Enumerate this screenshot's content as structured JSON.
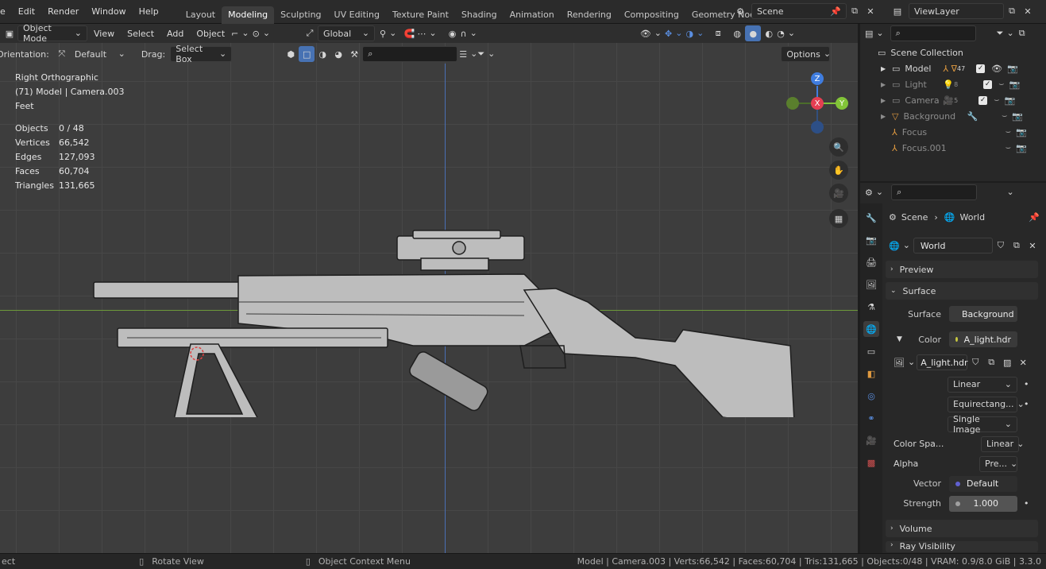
{
  "menu": [
    "e",
    "Edit",
    "Render",
    "Window",
    "Help"
  ],
  "workspaces": [
    "Layout",
    "Modeling",
    "Sculpting",
    "UV Editing",
    "Texture Paint",
    "Shading",
    "Animation",
    "Rendering",
    "Compositing",
    "Geometry Noc"
  ],
  "active_workspace": "Modeling",
  "scene_name": "Scene",
  "view_layer": "ViewLayer",
  "viewport_header": {
    "mode": "Object Mode",
    "view": "View",
    "select": "Select",
    "add": "Add",
    "object": "Object",
    "transform": "Global",
    "orientation_label": "Orientation:",
    "orientation_value": "Default",
    "drag_label": "Drag:",
    "drag_value": "Select Box",
    "options": "Options"
  },
  "overlay": {
    "view_name": "Right Orthographic",
    "object_info": "(71) Model | Camera.003",
    "units": "Feet",
    "stats": [
      {
        "label": "Objects",
        "value": "0 / 48"
      },
      {
        "label": "Vertices",
        "value": "66,542"
      },
      {
        "label": "Edges",
        "value": "127,093"
      },
      {
        "label": "Faces",
        "value": "60,704"
      },
      {
        "label": "Triangles",
        "value": "131,665"
      }
    ]
  },
  "gizmo": {
    "x": "X",
    "y": "Y",
    "z": "Z"
  },
  "outliner": {
    "title": "Scene Collection",
    "items": [
      {
        "name": "Model",
        "badge": "47",
        "dim": false
      },
      {
        "name": "Light",
        "badge": "8",
        "dim": true
      },
      {
        "name": "Camera",
        "badge": "5",
        "dim": true
      },
      {
        "name": "Background",
        "badge": "",
        "dim": true
      },
      {
        "name": "Focus",
        "badge": "",
        "dim": true
      },
      {
        "name": "Focus.001",
        "badge": "",
        "dim": true
      }
    ]
  },
  "properties": {
    "breadcrumb_scene": "Scene",
    "breadcrumb_world": "World",
    "world_name": "World",
    "preview": "Preview",
    "surface_section": "Surface",
    "surface_label": "Surface",
    "surface_value": "Background",
    "color_label": "Color",
    "color_value": "A_light.hdr",
    "image_name": "A_light.hdr",
    "interpolation": "Linear",
    "projection": "Equirectang...",
    "source": "Single Image",
    "colorspace_label": "Color Spa...",
    "colorspace_value": "Linear",
    "alpha_label": "Alpha",
    "alpha_value": "Pre...",
    "vector_label": "Vector",
    "vector_value": "Default",
    "strength_label": "Strength",
    "strength_value": "1.000",
    "volume": "Volume",
    "ray_visibility": "Ray Visibility"
  },
  "statusbar": {
    "left": "ect",
    "rotate": "Rotate View",
    "context": "Object Context Menu",
    "right": "Model | Camera.003 | Verts:66,542 | Faces:60,704 | Tris:131,665 | Objects:0/48 | VRAM: 0.9/8.0 GiB | 3.3.0"
  },
  "colors": {
    "accent": "#4772b3",
    "x_axis": "#e43e52",
    "y_axis": "#82c438",
    "z_axis": "#3f7de0"
  }
}
